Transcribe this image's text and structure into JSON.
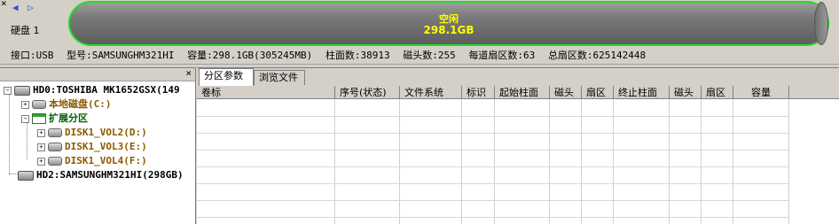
{
  "topbar": {
    "close_glyph": "×",
    "nav_arrows": "◀ ▷",
    "disk_label": "硬盘 1",
    "free_label": "空闲",
    "free_size": "298.1GB",
    "bar_color": "#22dd22",
    "free_text_color": "#ffff00"
  },
  "info": {
    "interface": "接口:USB",
    "model": "型号:SAMSUNGHM321HI",
    "capacity": "容量:298.1GB(305245MB)",
    "cylinders": "柱面数:38913",
    "heads": "磁头数:255",
    "sectors_per_track": "每道扇区数:63",
    "total_sectors": "总扇区数:625142448"
  },
  "left": {
    "close_glyph": "×",
    "tree": [
      {
        "label": "HD0:TOSHIBA MK1652GSX(149",
        "style": "black"
      },
      {
        "label": "本地磁盘(C:)",
        "style": "brown"
      },
      {
        "label": "扩展分区",
        "style": "greenbold"
      },
      {
        "label": "DISK1_VOL2(D:)",
        "style": "brown"
      },
      {
        "label": "DISK1_VOL3(E:)",
        "style": "brown"
      },
      {
        "label": "DISK1_VOL4(F:)",
        "style": "brown"
      },
      {
        "label": "HD2:SAMSUNGHM321HI(298GB)",
        "style": "black"
      }
    ]
  },
  "right": {
    "tabs": [
      "分区参数",
      "浏览文件"
    ],
    "columns": [
      "卷标",
      "序号(状态)",
      "文件系统",
      "标识",
      "起始柱面",
      "磁头",
      "扇区",
      "终止柱面",
      "磁头",
      "扇区",
      "容量"
    ]
  }
}
